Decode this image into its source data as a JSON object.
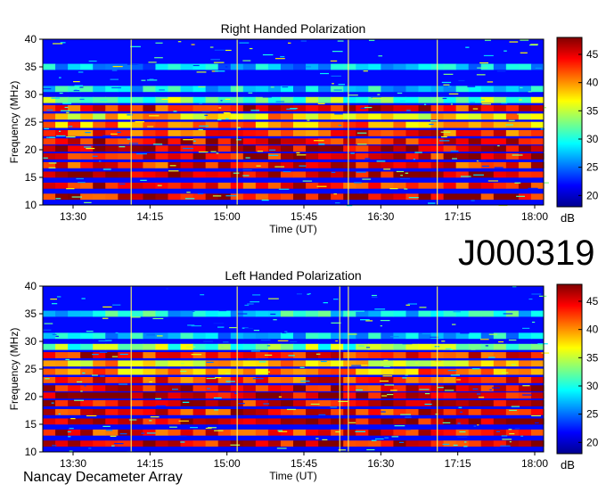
{
  "chart_data": [
    {
      "type": "heatmap",
      "title": "Right Handed Polarization",
      "xlabel": "Time (UT)",
      "ylabel": "Frequency (MHz)",
      "x_ticks": [
        "13:30",
        "14:15",
        "15:00",
        "15:45",
        "16:30",
        "17:15",
        "18:00"
      ],
      "y_ticks": [
        "10",
        "15",
        "20",
        "25",
        "30",
        "35",
        "40"
      ],
      "ylim": [
        10,
        40
      ],
      "colorbar": {
        "label": "dB",
        "ticks": [
          "20",
          "25",
          "30",
          "35",
          "40",
          "45"
        ],
        "range": [
          18,
          48
        ]
      },
      "bands": [
        {
          "freq": 11.5,
          "level": 45
        },
        {
          "freq": 13.5,
          "level": 44
        },
        {
          "freq": 15.5,
          "level": 46
        },
        {
          "freq": 17.2,
          "level": 44
        },
        {
          "freq": 18.8,
          "level": 45
        },
        {
          "freq": 20.2,
          "level": 46
        },
        {
          "freq": 21.5,
          "level": 45
        },
        {
          "freq": 23.0,
          "level": 43
        },
        {
          "freq": 24.5,
          "level": 40
        },
        {
          "freq": 26.0,
          "level": 38
        },
        {
          "freq": 27.5,
          "level": 44
        },
        {
          "freq": 29.0,
          "level": 33
        },
        {
          "freq": 31.0,
          "level": 28
        },
        {
          "freq": 35.0,
          "level": 27
        }
      ],
      "background_level": 22,
      "vertical_lines": [
        "14:04",
        "15:06",
        "16:11",
        "17:03"
      ]
    },
    {
      "type": "heatmap",
      "title": "Left Handed Polarization",
      "xlabel": "Time (UT)",
      "ylabel": "Frequency (MHz)",
      "x_ticks": [
        "13:30",
        "14:15",
        "15:00",
        "15:45",
        "16:30",
        "17:15",
        "18:00"
      ],
      "y_ticks": [
        "10",
        "15",
        "20",
        "25",
        "30",
        "35",
        "40"
      ],
      "ylim": [
        10,
        40
      ],
      "colorbar": {
        "label": "dB",
        "ticks": [
          "20",
          "25",
          "30",
          "35",
          "40",
          "45"
        ],
        "range": [
          18,
          48
        ]
      },
      "bands": [
        {
          "freq": 11.5,
          "level": 45
        },
        {
          "freq": 13.5,
          "level": 44
        },
        {
          "freq": 15.5,
          "level": 46
        },
        {
          "freq": 17.2,
          "level": 44
        },
        {
          "freq": 18.8,
          "level": 45
        },
        {
          "freq": 20.2,
          "level": 46
        },
        {
          "freq": 21.5,
          "level": 45
        },
        {
          "freq": 23.0,
          "level": 43
        },
        {
          "freq": 24.5,
          "level": 40
        },
        {
          "freq": 26.0,
          "level": 38
        },
        {
          "freq": 27.5,
          "level": 44
        },
        {
          "freq": 29.0,
          "level": 33
        },
        {
          "freq": 31.0,
          "level": 28
        },
        {
          "freq": 35.0,
          "level": 29
        }
      ],
      "background_level": 22,
      "vertical_lines": [
        "14:04",
        "15:06",
        "16:11",
        "17:03",
        "16:06"
      ]
    }
  ],
  "identifier": "J000319",
  "footer": "Nancay Decameter Array",
  "colors": {
    "axis": "#000000",
    "line": "#ffff66",
    "background": "#ffffff"
  }
}
